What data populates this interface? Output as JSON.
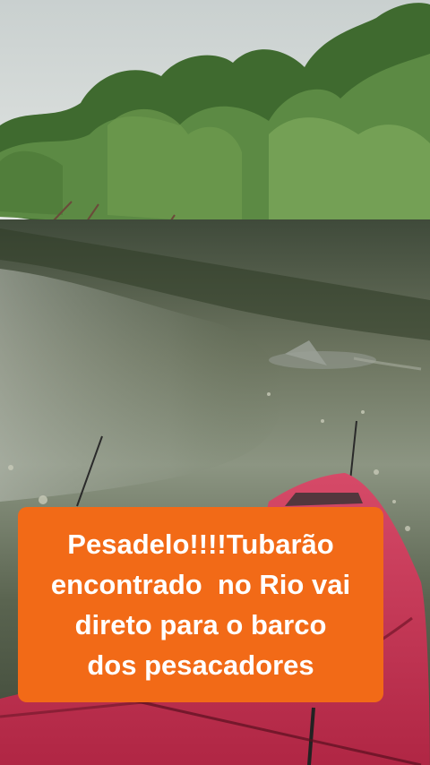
{
  "caption": {
    "lines": [
      "Pesadelo!!!!Tubarão",
      "encontrado  no Rio vai",
      "direto para o barco",
      "dos pesacadores"
    ],
    "background_color": "#f26a17",
    "text_color": "#ffffff"
  },
  "scene": {
    "description_icons": [
      "mangrove-trees",
      "river-water",
      "shark-fin",
      "red-kayak",
      "fishing-rod"
    ]
  }
}
